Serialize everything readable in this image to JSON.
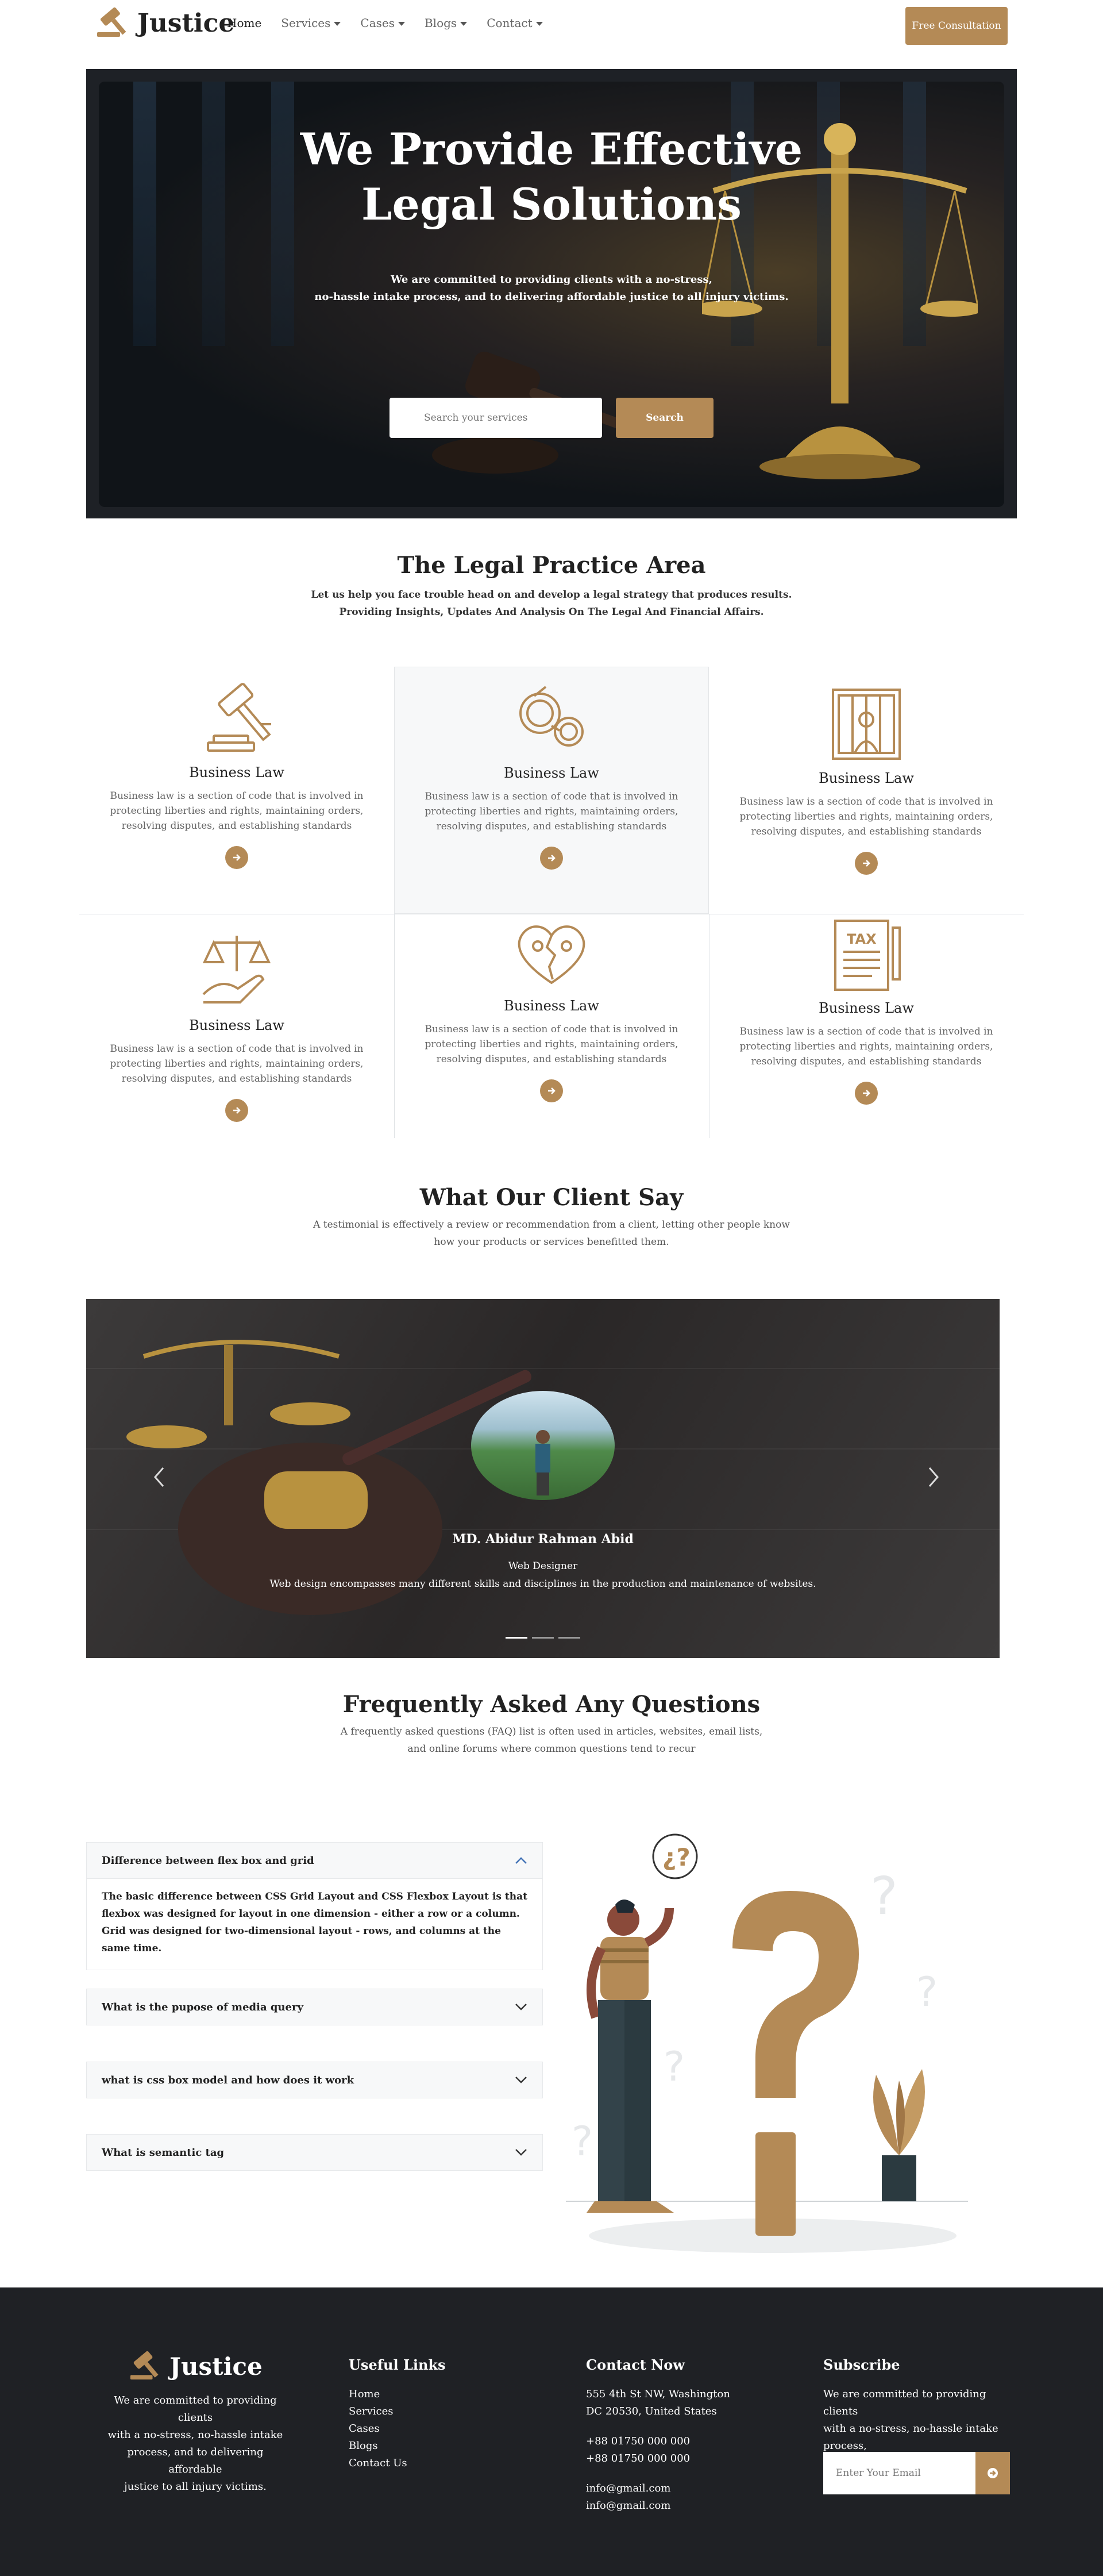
{
  "nav": {
    "brand": "Justice",
    "links": [
      {
        "label": "Home",
        "dropdown": false,
        "active": true
      },
      {
        "label": "Services",
        "dropdown": true
      },
      {
        "label": "Cases",
        "dropdown": true
      },
      {
        "label": "Blogs",
        "dropdown": true
      },
      {
        "label": "Contact",
        "dropdown": true
      }
    ],
    "cta": "Free Consultation"
  },
  "hero": {
    "title_line1": "We Provide Effective",
    "title_line2": "Legal Solutions",
    "subtitle_line1": "We are committed to providing clients with a no-stress,",
    "subtitle_line2": "no-hassle intake process, and to delivering affordable justice to all injury victims.",
    "search_placeholder": "Search your services",
    "search_button": "Search"
  },
  "practice": {
    "title": "The Legal Practice Area",
    "subtitle_line1": "Let us help you face trouble head on and develop a legal strategy that produces results.",
    "subtitle_line2": "Providing Insights, Updates And Analysis On The Legal And Financial Affairs.",
    "items": [
      {
        "icon": "gavel-icon",
        "title": "Business Law",
        "desc": "Business law is a section of code that is involved in protecting liberties and rights, maintaining orders, resolving disputes, and establishing standards"
      },
      {
        "icon": "handcuffs-icon",
        "title": "Business Law",
        "desc": "Business law is a section of code that is involved in protecting liberties and rights, maintaining orders, resolving disputes, and establishing standards"
      },
      {
        "icon": "prison-bars-icon",
        "title": "Business Law",
        "desc": "Business law is a section of code that is involved in protecting liberties and rights, maintaining orders, resolving disputes, and establishing standards"
      },
      {
        "icon": "scales-hand-icon",
        "title": "Business Law",
        "desc": "Business law is a section of code that is involved in protecting liberties and rights, maintaining orders, resolving disputes, and establishing standards"
      },
      {
        "icon": "broken-heart-family-icon",
        "title": "Business Law",
        "desc": "Business law is a section of code that is involved in protecting liberties and rights, maintaining orders, resolving disputes, and establishing standards"
      },
      {
        "icon": "tax-document-icon",
        "title": "Business Law",
        "desc": "Business law is a section of code that is involved in protecting liberties and rights, maintaining orders, resolving disputes, and establishing standards"
      }
    ]
  },
  "testimonials": {
    "title": "What Our Client Say",
    "subtitle_line1": "A testimonial is effectively a review or recommendation from a client, letting other people know",
    "subtitle_line2": "how your products or services benefitted them.",
    "name": "MD. Abidur Rahman Abid",
    "role": "Web Designer",
    "quote": "Web design encompasses many different skills and disciplines in the production and maintenance of websites."
  },
  "faq": {
    "title": "Frequently Asked Any Questions",
    "subtitle_line1": "A frequently asked questions (FAQ) list is often used in articles, websites, email lists,",
    "subtitle_line2": "and online forums where common questions tend to recur",
    "items": [
      {
        "question": "Difference between flex box and grid",
        "answer": "The basic difference between CSS Grid Layout and CSS Flexbox Layout is that flexbox was designed for layout in one dimension - either a row or a column. Grid was designed for two-dimensional layout - rows, and columns at the same time.",
        "open": true
      },
      {
        "question": "What is the pupose of media query",
        "open": false
      },
      {
        "question": "what is css box model and how does it work",
        "open": false
      },
      {
        "question": "What is semantic tag",
        "open": false
      }
    ]
  },
  "footer": {
    "brand": "Justice",
    "about_line1": "We are committed to providing clients",
    "about_line2": "with a no-stress, no-hassle intake",
    "about_line3": "process, and to delivering affordable",
    "about_line4": "justice to all injury victims.",
    "links_title": "Useful Links",
    "links": [
      "Home",
      "Services",
      "Cases",
      "Blogs",
      "Contact Us"
    ],
    "contact_title": "Contact Now",
    "address_line1": "555 4th St NW, Washington",
    "address_line2": "DC 20530, United States",
    "phone1": "+88 01750 000 000",
    "phone2": "+88 01750 000 000",
    "email1": "info@gmail.com",
    "email2": "info@gmail.com",
    "subscribe_title": "Subscribe",
    "subscribe_line1": "We are committed to providing clients",
    "subscribe_line2": "with a no-stress, no-hassle intake",
    "subscribe_line3": "process,",
    "subscribe_placeholder": "Enter Your Email"
  },
  "colors": {
    "accent": "#b48a56",
    "dark": "#1f2125",
    "light_bg": "#f7f8f9"
  }
}
